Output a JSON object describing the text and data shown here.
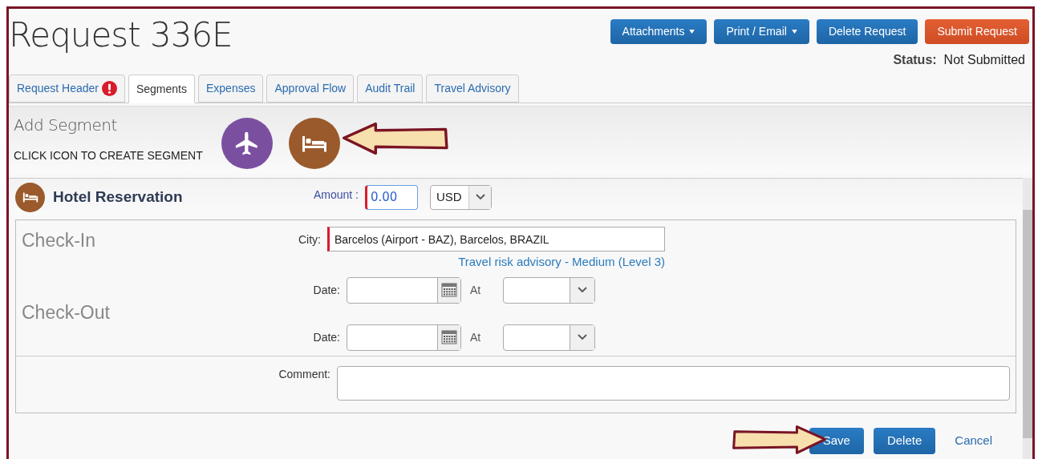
{
  "header": {
    "title": "Request 336E",
    "actions": [
      {
        "label": "Attachments",
        "kind": "primary",
        "dropdown": true
      },
      {
        "label": "Print / Email",
        "kind": "primary",
        "dropdown": true
      },
      {
        "label": "Delete Request",
        "kind": "primary",
        "dropdown": false
      },
      {
        "label": "Submit Request",
        "kind": "danger",
        "dropdown": false
      }
    ],
    "status_label": "Status:",
    "status_value": "Not Submitted"
  },
  "tabs": [
    {
      "label": "Request Header",
      "selected": false,
      "alert": true
    },
    {
      "label": "Segments",
      "selected": true,
      "alert": false
    },
    {
      "label": "Expenses",
      "selected": false,
      "alert": false
    },
    {
      "label": "Approval Flow",
      "selected": false,
      "alert": false
    },
    {
      "label": "Audit Trail",
      "selected": false,
      "alert": false
    },
    {
      "label": "Travel Advisory",
      "selected": false,
      "alert": false
    }
  ],
  "add_segment": {
    "title": "Add Segment",
    "hint": "CLICK ICON TO CREATE SEGMENT",
    "icons": [
      {
        "kind": "air",
        "color": "#7b4fa0"
      },
      {
        "kind": "hotel",
        "color": "#9a5a2c"
      }
    ]
  },
  "hotel": {
    "title": "Hotel Reservation",
    "amount_label": "Amount :",
    "amount": "0.00",
    "currency": "USD",
    "check_in": {
      "title": "Check-In",
      "city_label": "City:",
      "city": "Barcelos (Airport - BAZ), Barcelos, BRAZIL",
      "advisory": "Travel risk advisory - Medium (Level 3)",
      "date_label": "Date:",
      "at_label": "At"
    },
    "check_out": {
      "title": "Check-Out",
      "date_label": "Date:",
      "at_label": "At"
    },
    "comment_label": "Comment:"
  },
  "footer_actions": [
    {
      "label": "Save",
      "kind": "primary"
    },
    {
      "label": "Delete",
      "kind": "primary"
    },
    {
      "label": "Cancel",
      "kind": "link"
    }
  ]
}
